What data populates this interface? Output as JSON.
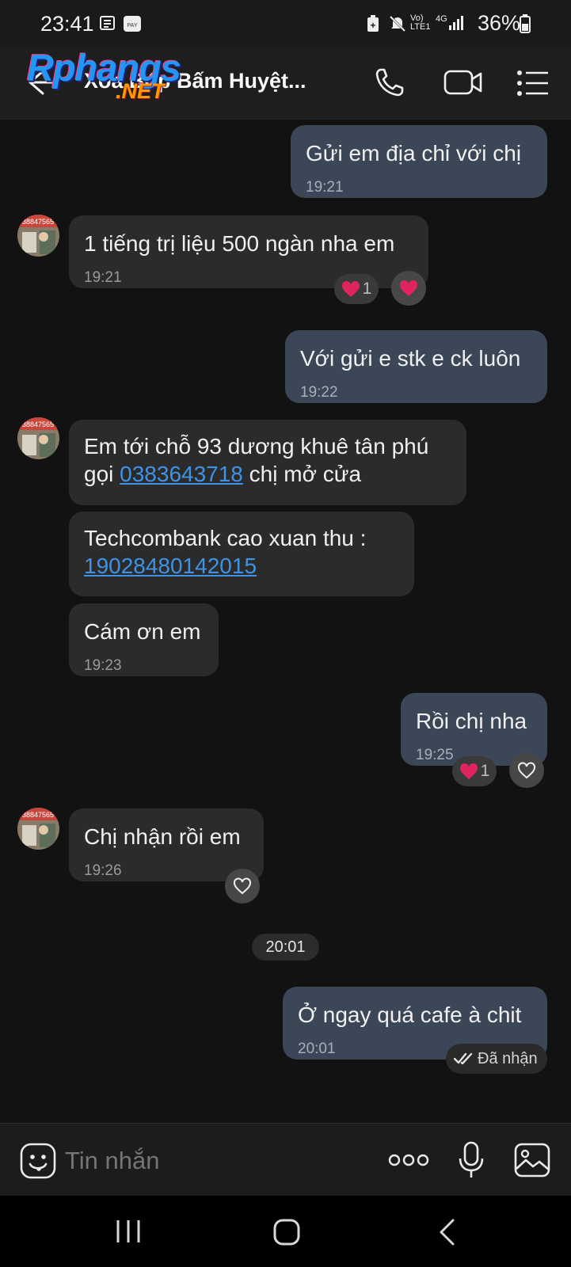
{
  "status_bar": {
    "time": "23:41",
    "network": "Vo) LTE1",
    "signal_type": "4G",
    "battery": "36%"
  },
  "header": {
    "title": "Xoa Bóp Bấm Huyệt...",
    "watermark_main": "Rphangs",
    "watermark_tld": ".NET"
  },
  "messages": [
    {
      "side": "out",
      "text": "Gửi em địa chỉ với chị",
      "time": "19:21"
    },
    {
      "side": "in",
      "text": "1 tiếng trị liệu 500 ngàn nha em",
      "time": "19:21",
      "reaction_count": "1"
    },
    {
      "side": "out",
      "text": "Với gửi e stk e ck luôn",
      "time": "19:22"
    },
    {
      "side": "in",
      "line1": "Em tới chỗ 93 dương khuê tân phú",
      "line2_pre": "gọi ",
      "phone": "0383643718",
      "line2_post": " chị mở cửa"
    },
    {
      "side": "in",
      "line1": "Techcombank cao xuan thu :",
      "account": "19028480142015"
    },
    {
      "side": "in",
      "text": "Cám ơn em",
      "time": "19:23"
    },
    {
      "side": "out",
      "text": "Rồi chị nha",
      "time": "19:25",
      "reaction_count": "1"
    },
    {
      "side": "in",
      "text": "Chị nhận rồi em",
      "time": "19:26"
    },
    {
      "side": "out",
      "text": "Ở ngay quá cafe à chit",
      "time": "20:01"
    }
  ],
  "date_divider": "20:01",
  "message_status": "Đã nhận",
  "composer": {
    "placeholder": "Tin nhắn"
  },
  "avatar_text": "38847565",
  "colors": {
    "background": "#121212",
    "incoming_bubble": "#2b2b2b",
    "outgoing_bubble": "#3b4756",
    "link": "#3f93e6",
    "heart": "#e0245e"
  },
  "icons": [
    "back-arrow-icon",
    "phone-icon",
    "video-call-icon",
    "menu-list-icon",
    "sticker-icon",
    "more-icon",
    "microphone-icon",
    "image-icon",
    "heart-icon",
    "double-check-icon",
    "recents-icon",
    "home-icon",
    "nav-back-icon"
  ]
}
